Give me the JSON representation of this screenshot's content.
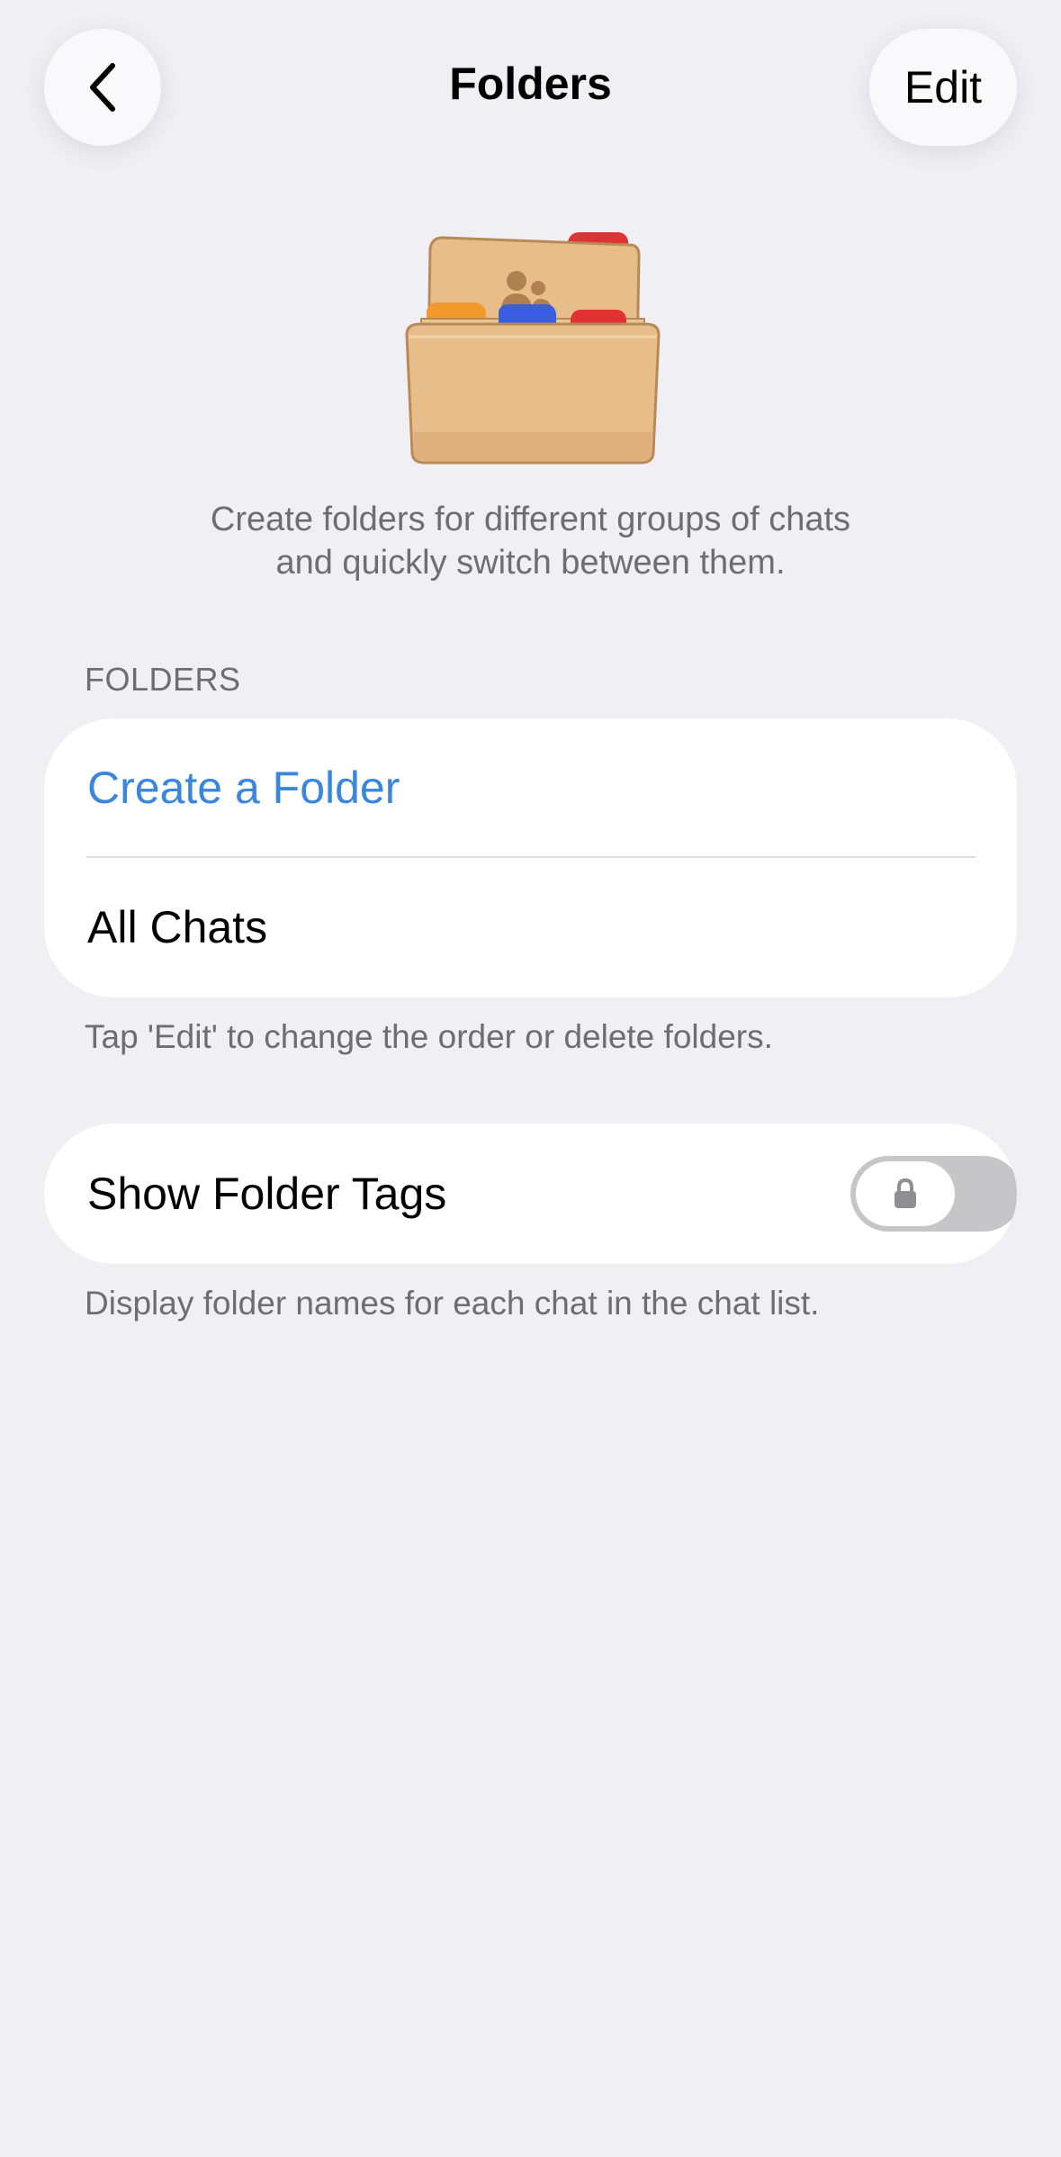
{
  "nav": {
    "title": "Folders",
    "edit_label": "Edit",
    "back_icon": "chevron-left-icon"
  },
  "hero": {
    "icon": "folders-illustration-icon",
    "description_line1": "Create folders for different groups of chats",
    "description_line2": "and quickly switch between them."
  },
  "folders_section": {
    "header": "FOLDERS",
    "create_label": "Create a Folder",
    "items": [
      {
        "label": "All Chats"
      }
    ],
    "footer": "Tap 'Edit' to change the order or delete folders."
  },
  "tags_section": {
    "toggle_label": "Show Folder Tags",
    "toggle_on": false,
    "toggle_locked": true,
    "lock_icon": "lock-icon",
    "footer": "Display folder names for each chat in the chat list."
  },
  "colors": {
    "background": "#efeff4",
    "accent": "#3a86df",
    "secondary_text": "#6d6d72",
    "toggle_off": "#c6c6c9"
  }
}
